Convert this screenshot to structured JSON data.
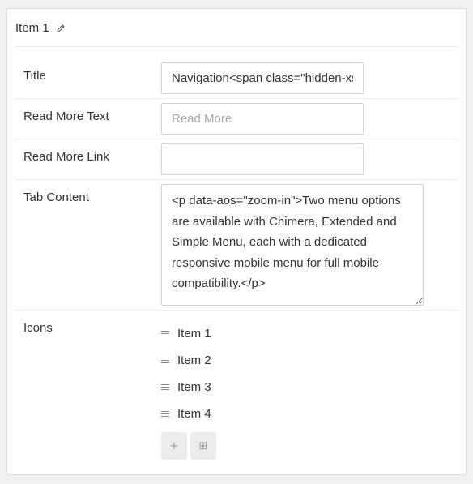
{
  "panel": {
    "title": "Item 1",
    "edit_icon": "pencil-icon"
  },
  "fields": {
    "title": {
      "label": "Title",
      "value": "Navigation<span class=\"hidden-xs\">"
    },
    "read_more_text": {
      "label": "Read More Text",
      "value": "",
      "placeholder": "Read More"
    },
    "read_more_link": {
      "label": "Read More Link",
      "value": ""
    },
    "tab_content": {
      "label": "Tab Content",
      "value": "<p data-aos=\"zoom-in\">Two menu options are available with Chimera, Extended and Simple Menu, each with a dedicated responsive mobile menu for full mobile compatibility.</p>"
    },
    "icons": {
      "label": "Icons",
      "items": [
        "Item 1",
        "Item 2",
        "Item 3",
        "Item 4"
      ],
      "drag_icon": "drag-handle-icon",
      "add_button_glyph": "+",
      "grid_button_glyph": "⊞"
    }
  }
}
